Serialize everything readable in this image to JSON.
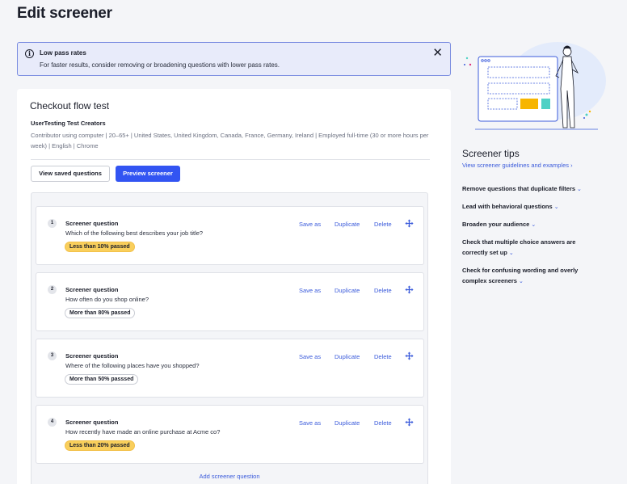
{
  "page": {
    "title": "Edit screener"
  },
  "alert": {
    "title": "Low pass rates",
    "body": "For faster results, consider removing or broadening questions with lower pass rates.",
    "info_icon": "info-icon",
    "close_icon": "close-icon",
    "close_glyph": "✕"
  },
  "test": {
    "title": "Checkout flow test",
    "org": "UserTesting Test Creators",
    "criteria": "Contributor using computer | 20–65+ | United States, United Kingdom, Canada, France, Germany, Ireland | Employed full-time (30 or more hours per week) | English | Chrome"
  },
  "buttons": {
    "view_saved": "View saved questions",
    "preview": "Preview screener"
  },
  "questions": [
    {
      "num": "1",
      "label": "Screener question",
      "text": "Which of the following best describes your job title?",
      "badge": "Less than 10% passed",
      "badge_style": "warn"
    },
    {
      "num": "2",
      "label": "Screener question",
      "text": "How often do you shop online?",
      "badge": "More than 80% passed",
      "badge_style": "neutral"
    },
    {
      "num": "3",
      "label": "Screener question",
      "text": "Where of the following places have you shopped?",
      "badge": "More than 50% passsed",
      "badge_style": "neutral"
    },
    {
      "num": "4",
      "label": "Screener question",
      "text": "How recently have made an online purchase at Acme co?",
      "badge": "Less than 20% passed",
      "badge_style": "warn"
    }
  ],
  "question_actions": {
    "save_as": "Save as",
    "duplicate": "Duplicate",
    "delete": "Delete",
    "move_icon": "move-icon"
  },
  "add_question": "Add screener question",
  "tips": {
    "title": "Screener tips",
    "link": "View screener guidelines and examples ›",
    "items": [
      "Remove questions that duplicate filters",
      "Lead with behavioral questions",
      "Broaden your audience",
      "Check that multiple choice answers are correctly set up",
      "Check for confusing wording and overly complex screeners"
    ],
    "chevron_icon": "chevron-down-icon"
  },
  "colors": {
    "primary": "#3254f2",
    "link": "#3b5bdb",
    "warn_badge": "#f9cf5c",
    "alert_bg": "#e8ebfa",
    "alert_border": "#7a8ce0",
    "illustration_yellow": "#f7b500",
    "illustration_teal": "#4fd1c5"
  }
}
